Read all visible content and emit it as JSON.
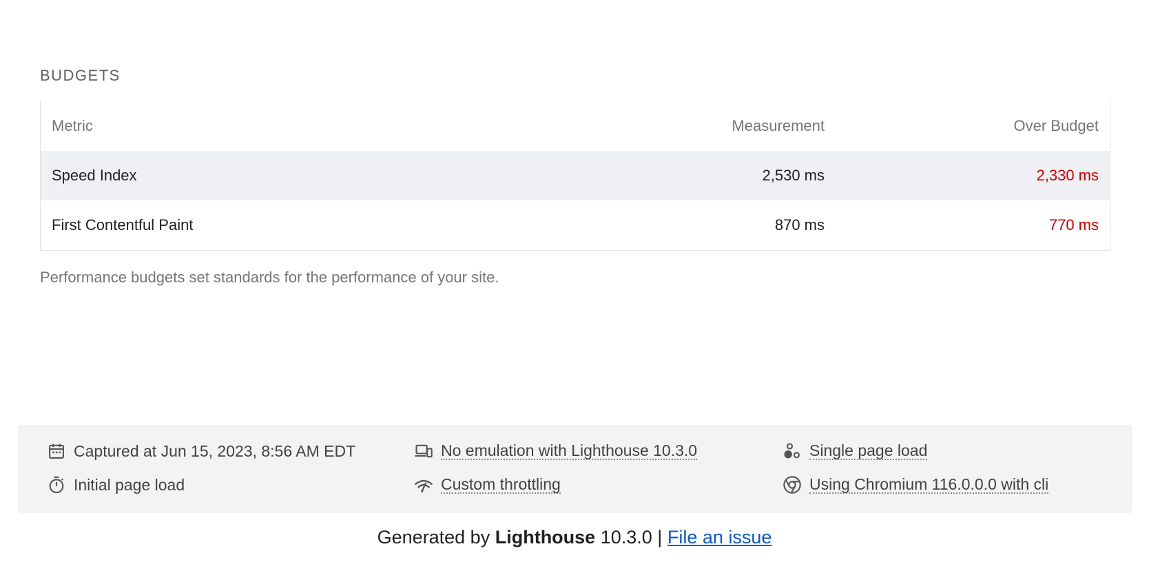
{
  "budgets": {
    "title": "BUDGETS",
    "columns": {
      "metric": "Metric",
      "measurement": "Measurement",
      "over_budget": "Over Budget"
    },
    "rows": [
      {
        "metric": "Speed Index",
        "measurement": "2,530 ms",
        "over_budget": "2,330 ms"
      },
      {
        "metric": "First Contentful Paint",
        "measurement": "870 ms",
        "over_budget": "770 ms"
      }
    ],
    "description": "Performance budgets set standards for the performance of your site."
  },
  "runtime": {
    "captured": "Captured at Jun 15, 2023, 8:56 AM EDT",
    "emulation": "No emulation with Lighthouse 10.3.0",
    "load_type": "Single page load",
    "initial": "Initial page load",
    "throttling": "Custom throttling",
    "browser": "Using Chromium 116.0.0.0 with cli"
  },
  "footer": {
    "generated_by": "Generated by",
    "brand": "Lighthouse",
    "version": "10.3.0 |",
    "issue_link": "File an issue"
  },
  "colors": {
    "over_budget": "#cc0000",
    "link": "#0b57d0",
    "striped_row": "#eef0f4",
    "runtime_bg": "#f3f3f3"
  },
  "icons": [
    "calendar-icon",
    "devices-icon",
    "circles-icon",
    "stopwatch-icon",
    "signal-icon",
    "chromium-icon"
  ]
}
